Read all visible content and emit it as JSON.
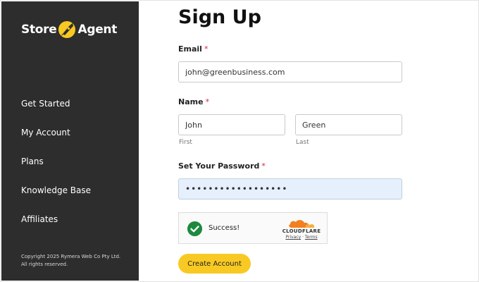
{
  "brand": {
    "left": "Store",
    "right": "Agent"
  },
  "sidebar": {
    "items": [
      {
        "label": "Get Started"
      },
      {
        "label": "My Account"
      },
      {
        "label": "Plans"
      },
      {
        "label": "Knowledge Base"
      },
      {
        "label": "Affiliates"
      }
    ],
    "copyright_line1": "Copyright 2025 Rymera Web Co Pty Ltd.",
    "copyright_line2": "All rights reserved."
  },
  "form": {
    "title": "Sign Up",
    "required_mark": "*",
    "email": {
      "label": "Email",
      "value": "john@greenbusiness.com"
    },
    "name": {
      "label": "Name",
      "first_value": "John",
      "first_sublabel": "First",
      "last_value": "Green",
      "last_sublabel": "Last"
    },
    "password": {
      "label": "Set Your Password",
      "value": "••••••••••••••••••"
    },
    "captcha": {
      "status": "Success!",
      "brand": "CLOUDFLARE",
      "privacy": "Privacy",
      "separator": "·",
      "terms": "Terms"
    },
    "submit_label": "Create Account"
  },
  "colors": {
    "sidebar_bg": "#2d2d2d",
    "accent_yellow": "#f8c923",
    "success_green": "#1d8a3e",
    "required_red": "#d6243a",
    "cloudflare_orange": "#f38020"
  }
}
